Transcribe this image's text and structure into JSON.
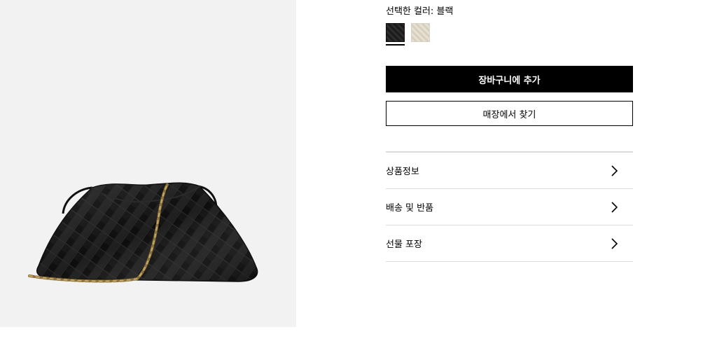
{
  "color_selector": {
    "label": "선택한 컬러: 블랙",
    "swatches": [
      {
        "name": "black",
        "selected": true,
        "color": "#1c1c1c"
      },
      {
        "name": "cream",
        "selected": false,
        "color": "#e0dacb"
      }
    ]
  },
  "buttons": {
    "add_to_cart": "장바구니에 추가",
    "find_in_store": "매장에서 찾기"
  },
  "accordion": [
    {
      "label": "상품정보",
      "icon": "chevron-right-icon"
    },
    {
      "label": "배송 및 반품",
      "icon": "chevron-right-icon"
    },
    {
      "label": "선물 포장",
      "icon": "chevron-right-icon"
    }
  ],
  "colors": {
    "primary_button": "#000000",
    "image_background": "#f1f2f1",
    "divider": "#dcdcdc"
  }
}
